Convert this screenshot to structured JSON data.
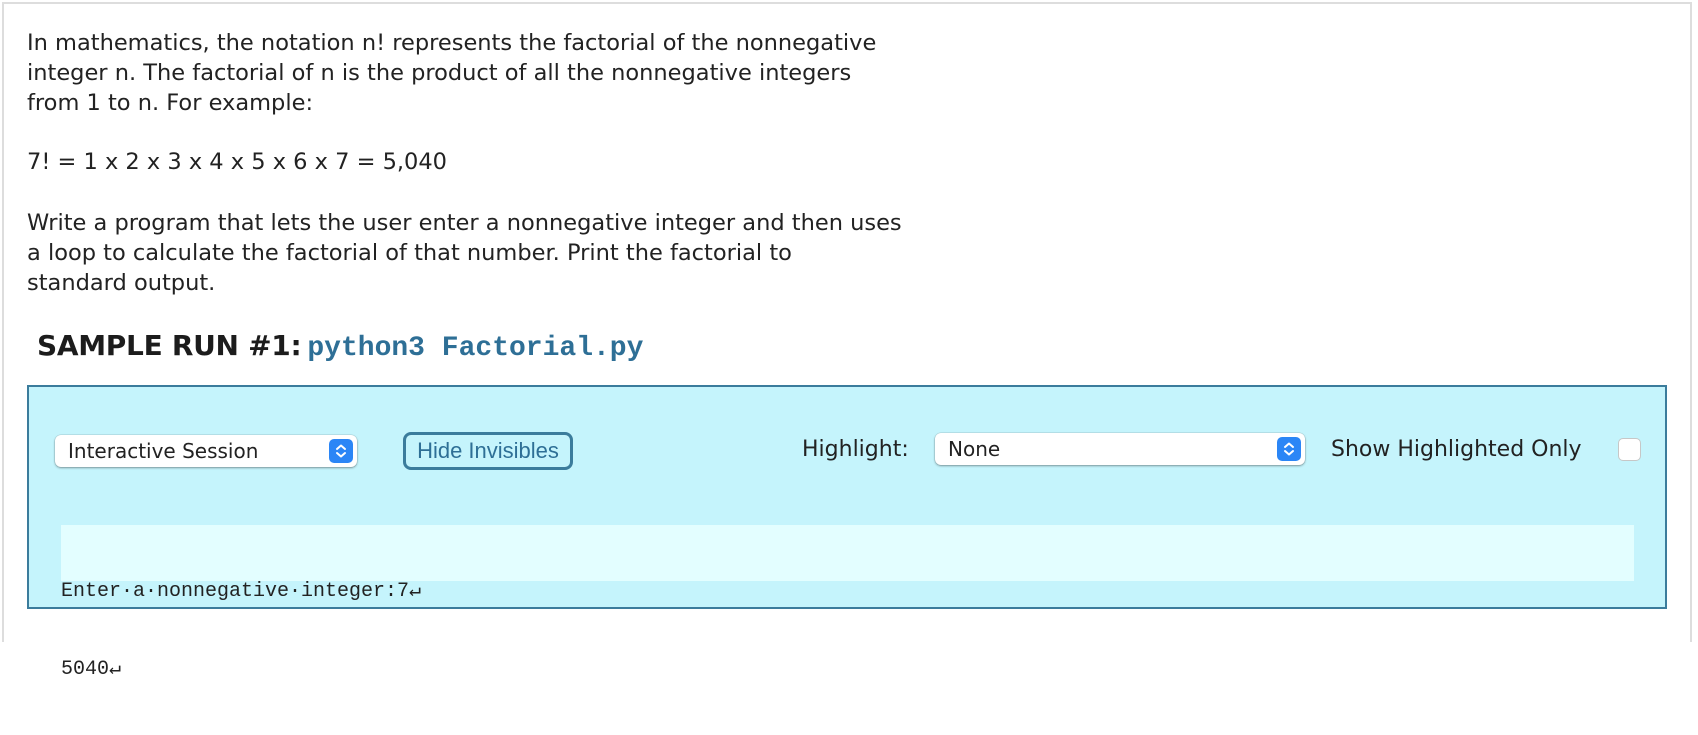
{
  "problem": {
    "intro_lines": [
      "In mathematics, the notation n! represents the factorial of the nonnegative",
      "integer n. The factorial of n is the product of all the nonnegative integers",
      "from 1 to n. For example:"
    ],
    "example": "7! = 1 x 2 x 3 x 4 x 5 x 6 x 7 = 5,040",
    "task_lines": [
      "Write a program that lets the user enter a nonnegative integer and then uses",
      "a loop to calculate the factorial of that number. Print the factorial to",
      "standard output."
    ]
  },
  "sample_run": {
    "label": "SAMPLE RUN #1:",
    "command": "python3 Factorial.py",
    "controls": {
      "session_select": {
        "selected": "Interactive Session",
        "icon": "up-down-stepper-icon"
      },
      "hide_invisibles_button": "Hide Invisibles",
      "highlight_label": "Highlight:",
      "highlight_select": {
        "selected": "None",
        "icon": "up-down-stepper-icon"
      },
      "show_highlighted_only_label": "Show Highlighted Only",
      "show_highlighted_only_checked": false
    },
    "output_lines": [
      "Enter·a·nonnegative·integer:7↵",
      "5040↵"
    ]
  },
  "colors": {
    "run_box_background": "#c5f4fc",
    "run_box_border": "#3b7c9c",
    "output_background": "#e3feff",
    "command_text": "#2e6f96",
    "stepper_blue": "#2b86f6"
  }
}
